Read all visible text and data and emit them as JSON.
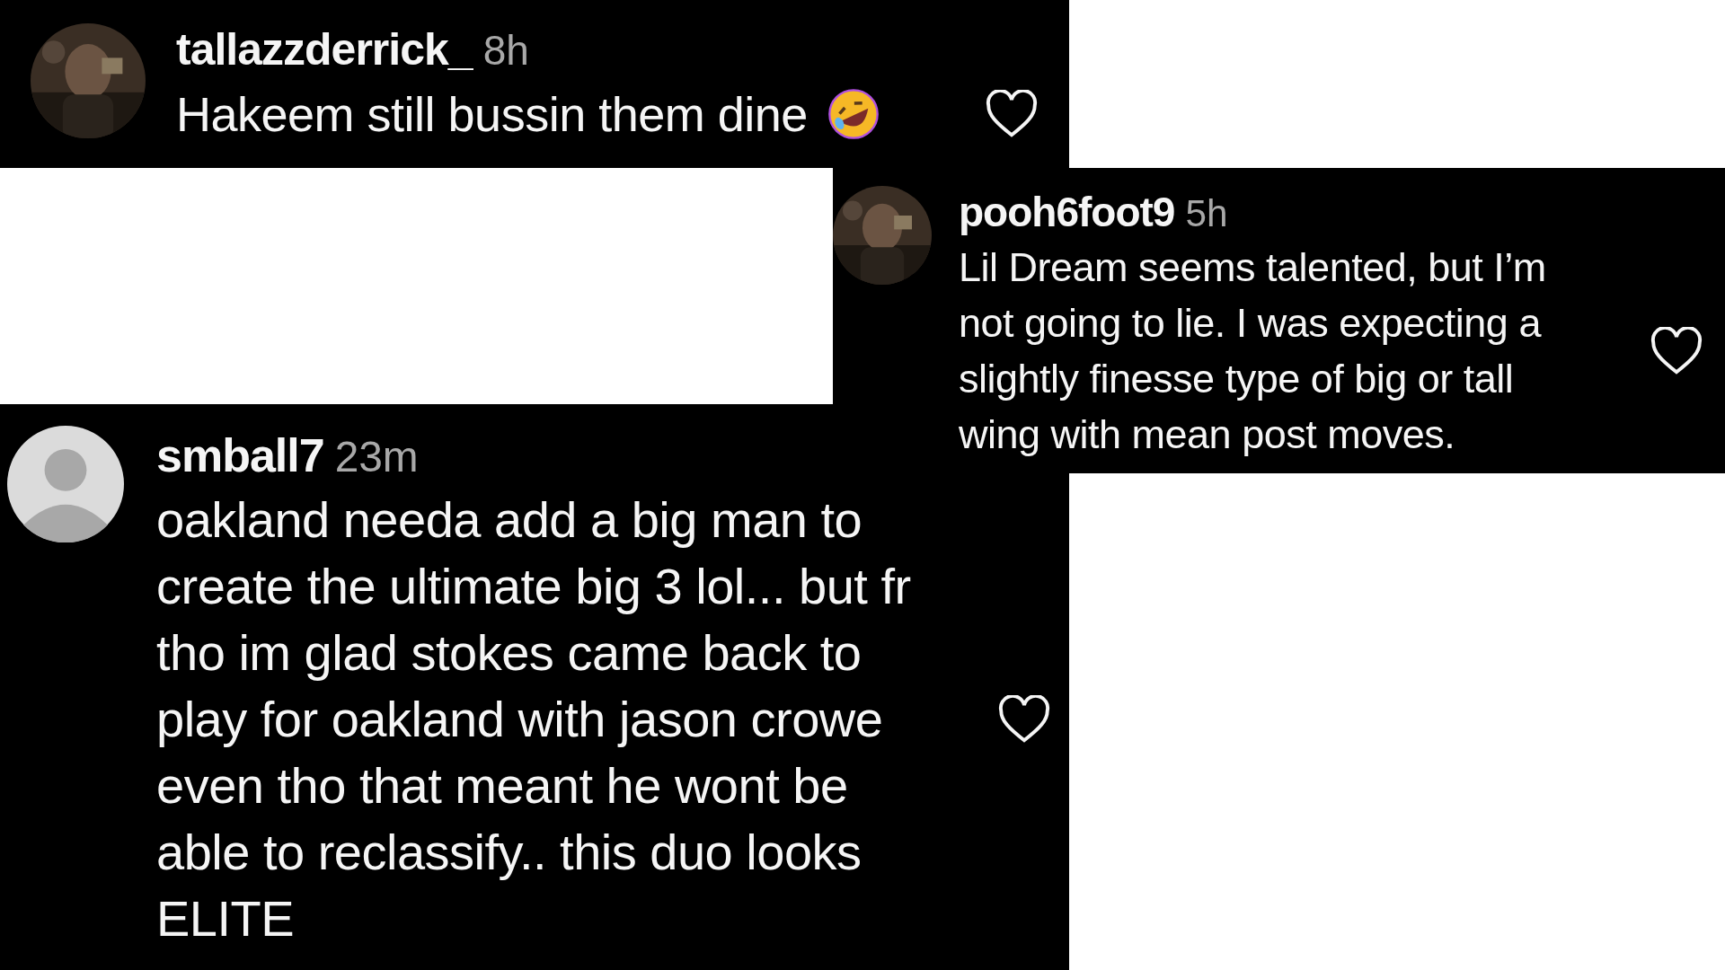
{
  "comments": [
    {
      "kind": "photo-avatar",
      "username": "tallazzderrick_",
      "time": "8h",
      "lines": [
        "Hakeem still bussin them dine"
      ],
      "emoji": true,
      "liked": false
    },
    {
      "kind": "photo-avatar",
      "username": "pooh6foot9",
      "time": "5h",
      "lines": [
        "Lil Dream seems talented, but I’m",
        "not going to lie. I was expecting a",
        "slightly finesse type of big or tall",
        "wing with mean post moves."
      ],
      "emoji": false,
      "liked": false
    },
    {
      "kind": "default-avatar",
      "username": "smball7",
      "time": "23m",
      "lines": [
        "oakland needa add a big man to",
        "create the ultimate big 3 lol... but fr",
        "tho im glad stokes came back to",
        "play for oakland with jason crowe",
        "even tho that meant he wont be",
        "able to reclassify.. this duo looks",
        "ELITE"
      ],
      "emoji": false,
      "liked": false
    }
  ]
}
